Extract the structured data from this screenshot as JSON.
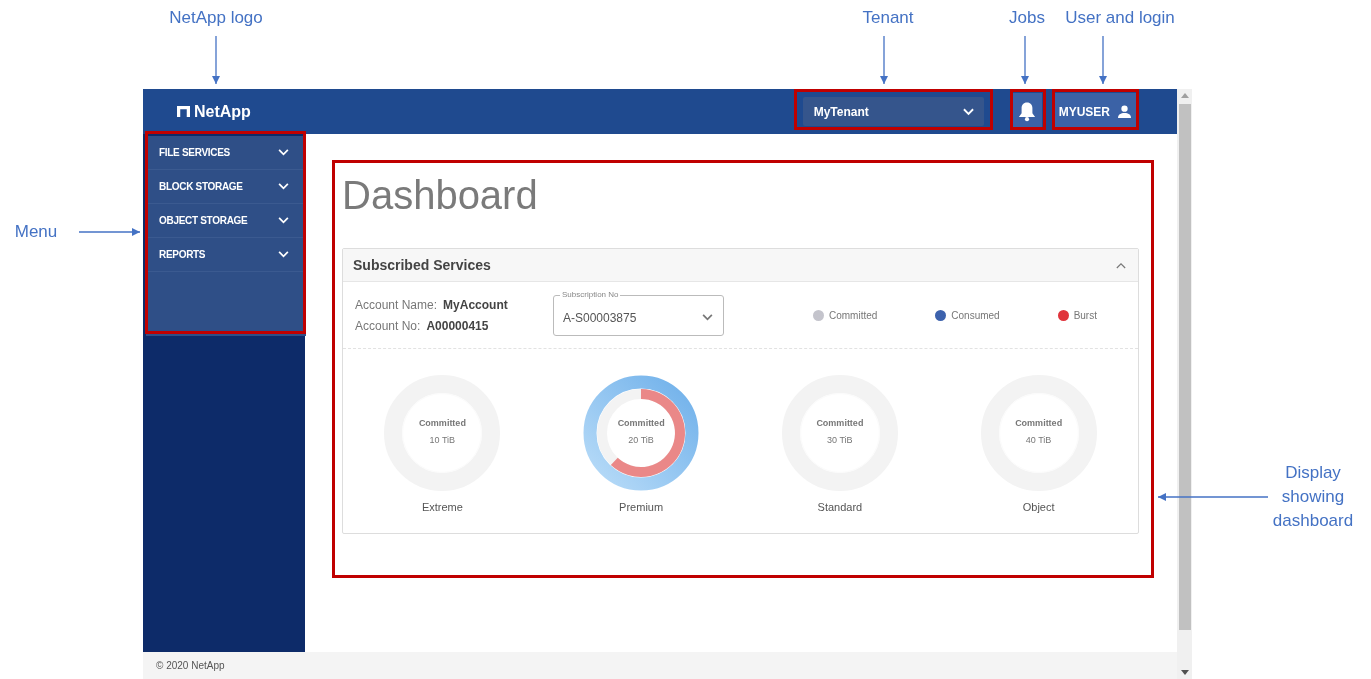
{
  "annotations": [
    {
      "label": "NetApp logo"
    },
    {
      "label": "Tenant"
    },
    {
      "label": "Jobs"
    },
    {
      "label": "User and login"
    },
    {
      "label": "Menu"
    },
    {
      "label": "Display showing dashboard"
    }
  ],
  "header": {
    "logo": "NetApp",
    "tenant": "MyTenant",
    "user": "MYUSER"
  },
  "sidebar": {
    "items": [
      {
        "label": "FILE SERVICES",
        "expanded": false
      },
      {
        "label": "BLOCK STORAGE",
        "expanded": false
      },
      {
        "label": "OBJECT STORAGE",
        "expanded": false
      },
      {
        "label": "REPORTS",
        "expanded": false
      }
    ]
  },
  "page_title": "Dashboard",
  "card": {
    "title": "Subscribed Services",
    "expanded": true,
    "account_name_label": "Account Name:",
    "account_name": "MyAccount",
    "account_no_label": "Account No:",
    "account_no": "A00000415",
    "subscription": {
      "label": "Subscription No",
      "value": "A-S00003875"
    },
    "legend": [
      {
        "label": "Committed",
        "color": "#c4c4cc"
      },
      {
        "label": "Consumed",
        "color": "#3d62ad"
      },
      {
        "label": "Burst",
        "color": "#e0343c"
      }
    ],
    "services": [
      {
        "name": "Extreme",
        "caption": "Committed",
        "amount": "10 TiB",
        "kind": "empty"
      },
      {
        "name": "Premium",
        "caption": "Committed",
        "amount": "20 TiB",
        "kind": "used"
      },
      {
        "name": "Standard",
        "caption": "Committed",
        "amount": "30 TiB",
        "kind": "empty"
      },
      {
        "name": "Object",
        "caption": "Committed",
        "amount": "40 TiB",
        "kind": "empty"
      }
    ]
  },
  "footer": "© 2020 NetApp"
}
